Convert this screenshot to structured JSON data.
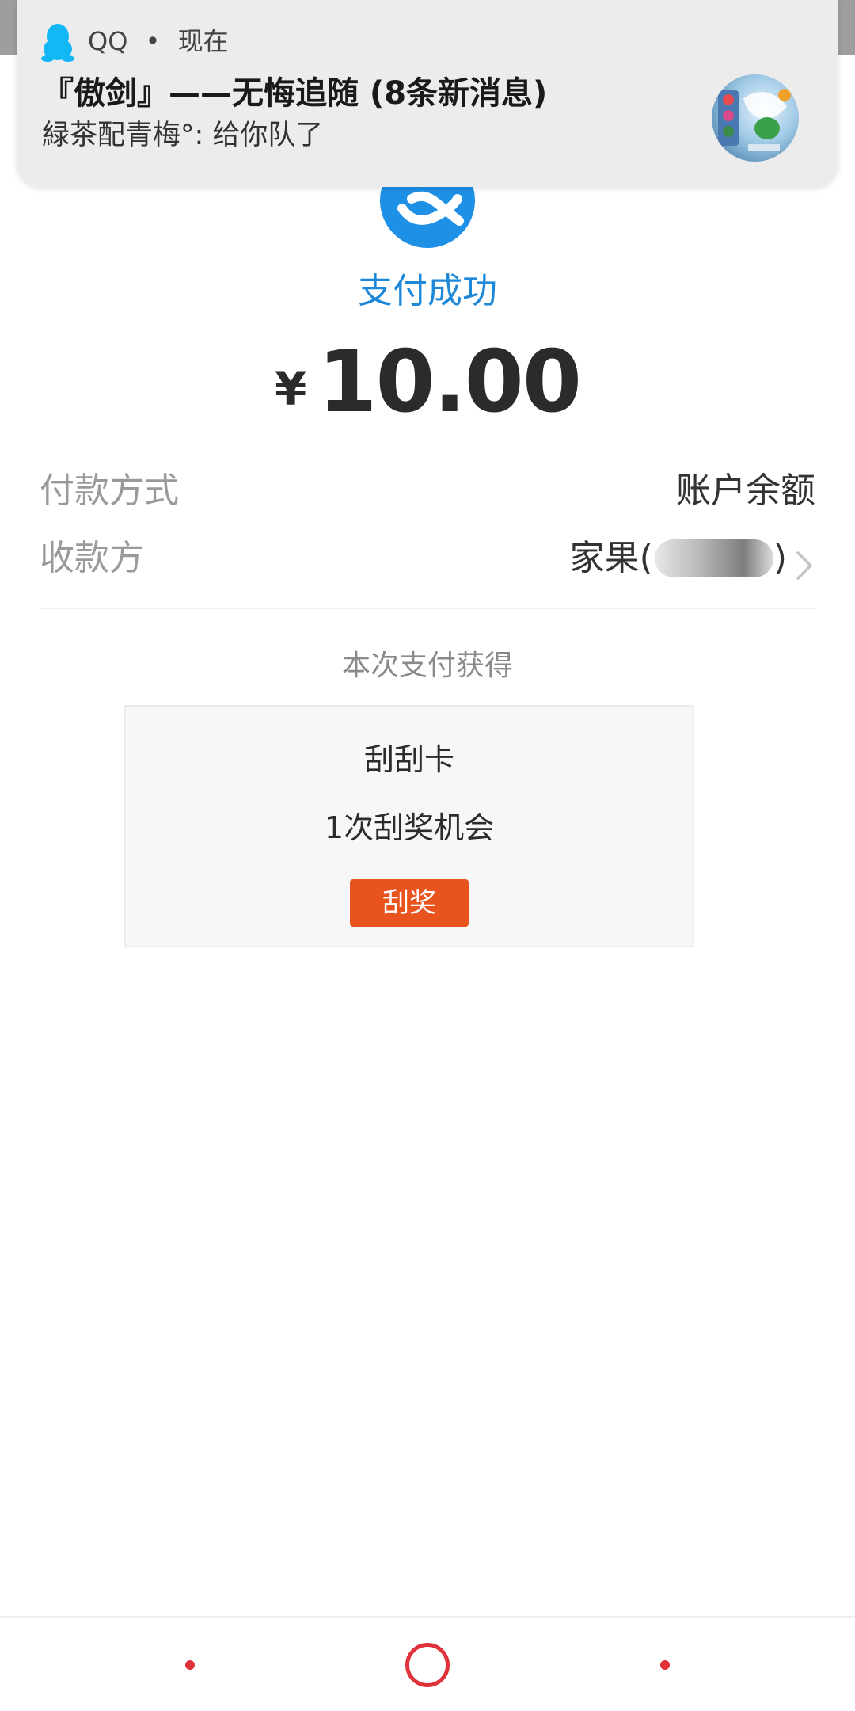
{
  "notification": {
    "app_name": "QQ",
    "time": "现在",
    "separator": "•",
    "title": "『傲剑』——无悔追随 (8条新消息)",
    "body": "緑茶配青梅°: 给你队了",
    "app_icon": "qq-penguin-icon",
    "thumbnail": "group-avatar"
  },
  "payment": {
    "status": "支付成功",
    "currency_symbol": "¥",
    "amount": "10.00",
    "method_label": "付款方式",
    "method_value": "账户余额",
    "payee_label": "收款方",
    "payee_value": "家果(",
    "payee_suffix": ")"
  },
  "reward": {
    "section_title": "本次支付获得",
    "card_title": "刮刮卡",
    "card_desc": "1次刮奖机会",
    "button_label": "刮奖"
  },
  "colors": {
    "alipay_blue": "#1e90e6",
    "success_text": "#1e88d8",
    "scratch_button": "#e8531e",
    "nav_red": "#e0323a"
  },
  "icons": {
    "alipay": "alipay-logo-icon",
    "chevron": "chevron-right-icon"
  }
}
